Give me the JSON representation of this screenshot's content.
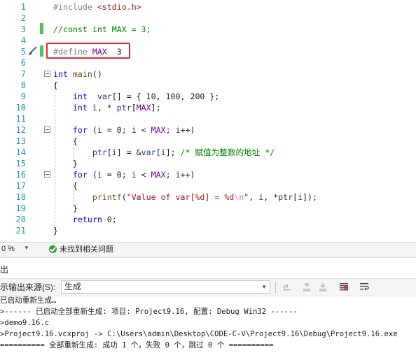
{
  "editor": {
    "lines": [
      {
        "n": "1",
        "parts": [
          [
            "pp",
            "#include "
          ],
          [
            "inc",
            "<stdio.h>"
          ]
        ]
      },
      {
        "n": "2",
        "parts": []
      },
      {
        "n": "3",
        "parts": [
          [
            "cmt",
            "//const int MAX = 3;"
          ]
        ]
      },
      {
        "n": "4",
        "parts": []
      },
      {
        "n": "5",
        "parts": [
          [
            "pp",
            "#define "
          ],
          [
            "mac",
            "MAX"
          ],
          [
            "",
            "  3"
          ]
        ]
      },
      {
        "n": "6",
        "parts": []
      },
      {
        "n": "7",
        "parts": [
          [
            "kw",
            "int "
          ],
          [
            "fn",
            "main"
          ],
          [
            "",
            "()"
          ]
        ]
      },
      {
        "n": "8",
        "parts": [
          [
            "",
            "{"
          ]
        ]
      },
      {
        "n": "9",
        "parts": [
          [
            "",
            "    "
          ],
          [
            "kw",
            "int "
          ],
          [
            "",
            " "
          ],
          [
            "var",
            "var"
          ],
          [
            "",
            "[] = { 10, 100, 200 };"
          ]
        ]
      },
      {
        "n": "10",
        "parts": [
          [
            "",
            "    "
          ],
          [
            "kw",
            "int "
          ],
          [
            "var",
            "i"
          ],
          [
            "",
            ", * "
          ],
          [
            "var",
            "ptr"
          ],
          [
            "",
            "["
          ],
          [
            "mac",
            "MAX"
          ],
          [
            "",
            "];"
          ]
        ]
      },
      {
        "n": "11",
        "parts": []
      },
      {
        "n": "12",
        "parts": [
          [
            "",
            "    "
          ],
          [
            "kw",
            "for "
          ],
          [
            "",
            "("
          ],
          [
            "var",
            "i"
          ],
          [
            "",
            " = 0; "
          ],
          [
            "var",
            "i"
          ],
          [
            "",
            " < "
          ],
          [
            "mac",
            "MAX"
          ],
          [
            "",
            "; "
          ],
          [
            "var",
            "i"
          ],
          [
            "",
            "++)"
          ]
        ]
      },
      {
        "n": "13",
        "parts": [
          [
            "",
            "    {"
          ]
        ]
      },
      {
        "n": "14",
        "parts": [
          [
            "",
            "        "
          ],
          [
            "var",
            "ptr"
          ],
          [
            "",
            "["
          ],
          [
            "var",
            "i"
          ],
          [
            "",
            "] = &"
          ],
          [
            "var",
            "var"
          ],
          [
            "",
            "["
          ],
          [
            "var",
            "i"
          ],
          [
            "",
            "]; "
          ],
          [
            "cmt",
            "/* 赋值为整数的地址 */"
          ]
        ]
      },
      {
        "n": "15",
        "parts": [
          [
            "",
            "    }"
          ]
        ]
      },
      {
        "n": "16",
        "parts": [
          [
            "",
            "    "
          ],
          [
            "kw",
            "for "
          ],
          [
            "",
            "("
          ],
          [
            "var",
            "i"
          ],
          [
            "",
            " = 0; "
          ],
          [
            "var",
            "i"
          ],
          [
            "",
            " < "
          ],
          [
            "mac",
            "MAX"
          ],
          [
            "",
            "; "
          ],
          [
            "var",
            "i"
          ],
          [
            "",
            "++)"
          ]
        ]
      },
      {
        "n": "17",
        "parts": [
          [
            "",
            "    {"
          ]
        ]
      },
      {
        "n": "18",
        "parts": [
          [
            "",
            "        "
          ],
          [
            "fn",
            "printf"
          ],
          [
            "",
            "("
          ],
          [
            "str",
            "\"Value of var[%d] = %d"
          ],
          [
            "esc",
            "\\n"
          ],
          [
            "str",
            "\""
          ],
          [
            "",
            ", "
          ],
          [
            "var",
            "i"
          ],
          [
            "",
            ", *"
          ],
          [
            "var",
            "ptr"
          ],
          [
            "",
            "["
          ],
          [
            "var",
            "i"
          ],
          [
            "",
            "]);"
          ]
        ]
      },
      {
        "n": "19",
        "parts": [
          [
            "",
            "    }"
          ]
        ]
      },
      {
        "n": "20",
        "parts": [
          [
            "",
            "    "
          ],
          [
            "kw",
            "return "
          ],
          [
            "",
            "0;"
          ]
        ]
      },
      {
        "n": "21",
        "parts": [
          [
            "",
            "}"
          ]
        ]
      }
    ]
  },
  "status": {
    "zoom": "0 %",
    "issues": "未找到相关问题"
  },
  "output": {
    "title": "出",
    "source_label": "示输出来源(S):",
    "source_value": "生成",
    "lines": [
      "已启动重新生成…",
      ">------ 已启动全部重新生成: 项目: Project9.16, 配置: Debug Win32 ------",
      ">demo9.16.c",
      ">Project9.16.vcxproj -> C:\\Users\\admin\\Desktop\\CODE-C-V\\Project9.16\\Debug\\Project9.16.exe",
      "========== 全部重新生成: 成功 1 个，失败 0 个，跳过 0 个 =========="
    ]
  },
  "colors": {
    "keyword": "#0000ff",
    "macro": "#6f008a",
    "comment": "#008000",
    "string": "#a31515",
    "line_number": "#2b91af",
    "highlight_box": "#e0282e",
    "change_bar": "#57c057"
  },
  "icons": [
    "brush-icon",
    "check-circle-icon",
    "chevron-down-icon",
    "indent-icon",
    "clear-all-icon",
    "word-wrap-icon"
  ]
}
